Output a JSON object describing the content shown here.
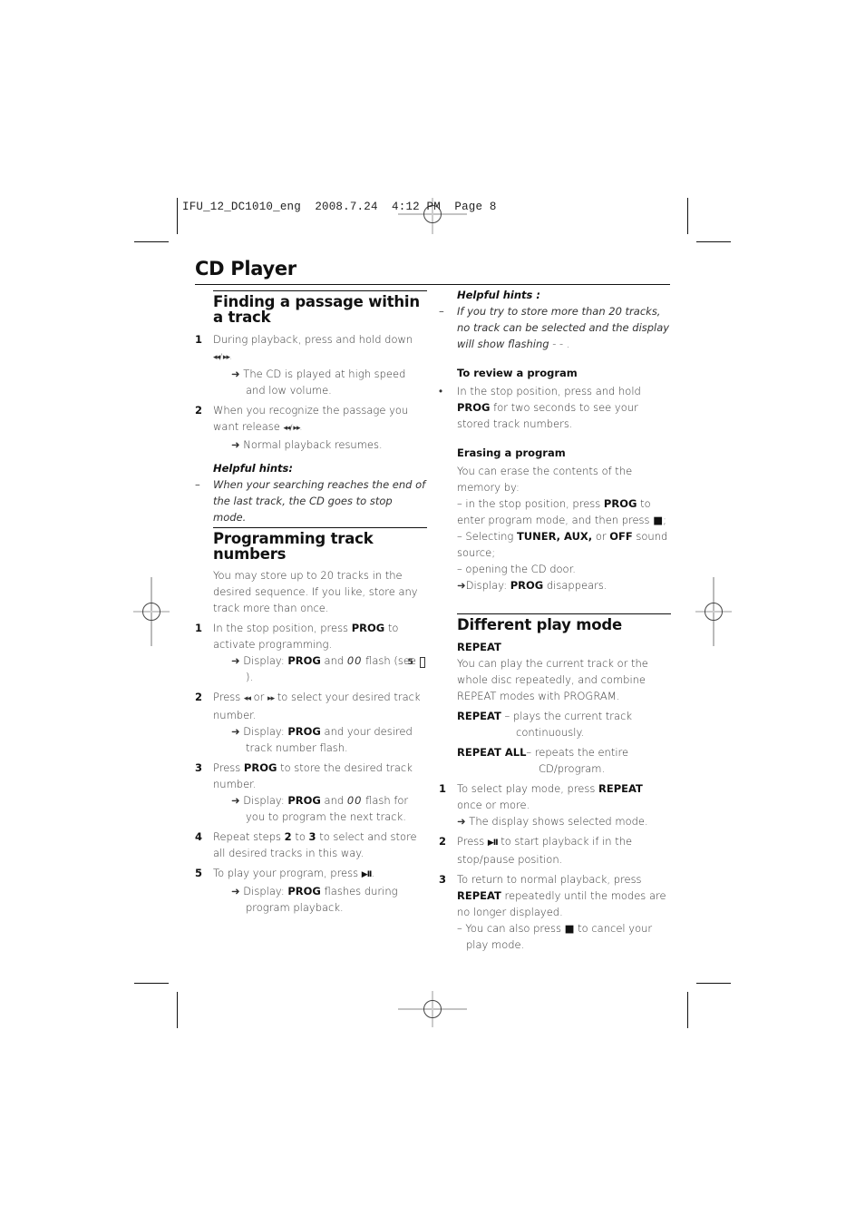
{
  "slug": {
    "file": "IFU_12_DC1010_eng",
    "date": "2008.7.24",
    "time": "4:12 PM",
    "page": "Page 8"
  },
  "page_title": "CD Player",
  "left": {
    "finding": {
      "heading": "Finding a passage within a track",
      "steps": [
        {
          "n": "1",
          "text": "During playback, press and hold down",
          "keys": "◂◂/ ▸▸.",
          "result": "➜ The CD is played at high speed and low volume."
        },
        {
          "n": "2",
          "text": "When you recognize the passage you want release",
          "keys": "◂◂/ ▸▸.",
          "result": "➜ Normal playback resumes."
        }
      ],
      "hints_title": "Helpful hints:",
      "hint_dash": "–",
      "hint": "When your searching reaches the end of the last track, the CD goes to stop mode."
    },
    "programming": {
      "heading": "Programming track numbers",
      "intro": "You may store up to 20 tracks in the desired sequence. If you like, store any track more than once.",
      "steps": [
        {
          "n": "1",
          "a": "In the stop position, press ",
          "b": "PROG",
          "c": " to activate programming.",
          "r1": "➜ Display: ",
          "r2": "PROG",
          "r3": " and ",
          "seg": "00",
          "r4": " flash (see ",
          "ref": "5",
          "r5": ")."
        },
        {
          "n": "2",
          "a": "Press ",
          "k1": "◂◂",
          "mid": " or ",
          "k2": "▸▸",
          "c": " to select your desired track number.",
          "r1": "➜ Display: ",
          "r2": "PROG",
          "r3": " and your desired track number flash."
        },
        {
          "n": "3",
          "a": "Press ",
          "b": "PROG",
          "c": " to store the desired track number.",
          "r1": "➜ Display: ",
          "r2": "PROG",
          "r3": " and ",
          "seg": "00",
          "r4": " flash for you to program the next track."
        },
        {
          "n": "4",
          "a": "Repeat steps ",
          "b1": "2",
          "mid": " to ",
          "b2": "3",
          "c": " to select and store all desired tracks in this way."
        },
        {
          "n": "5",
          "a": "To play your program, press ",
          "key": "▶II",
          "c": ".",
          "r1": "➜ Display: ",
          "r2": "PROG",
          "r3": " flashes during program playback."
        }
      ]
    }
  },
  "right": {
    "hints_title": "Helpful hints :",
    "hint_dash": "–",
    "hint": "If you try to store more than 20 tracks, no track can be selected and the display will show flashing",
    "hint_end": " - - .",
    "review": {
      "heading": "To review a program",
      "bullet": "•",
      "a": "In the stop position, press and hold ",
      "b": "PROG",
      "c": " for two seconds to see your stored track numbers."
    },
    "erasing": {
      "heading": "Erasing a program",
      "intro": "You can erase the contents of the memory by:",
      "l1a": "– in the stop position, press ",
      "l1b": "PROG",
      "l1c": " to enter program mode, and then press ",
      "stop": "■",
      "l1d": ";",
      "l2a": "– Selecting ",
      "l2b": "TUNER, AUX,",
      "l2c": " or ",
      "l2d": "OFF",
      "l2e": " sound source;",
      "l3": "– opening the CD door.",
      "l4a": "➜Display: ",
      "l4b": "PROG",
      "l4c": " disappears."
    },
    "playmode": {
      "heading": "Different play mode",
      "sub": "REPEAT",
      "intro": "You can play the current track or the whole disc repeatedly, and combine REPEAT modes with PROGRAM.",
      "m1_label": "REPEAT",
      "m1_text": " – plays the current track",
      "m1_cont": "continuously.",
      "m2_label": "REPEAT ALL",
      "m2_text": "– repeats the entire",
      "m2_cont": "CD/program.",
      "steps": [
        {
          "n": "1",
          "a": "To select play mode, press ",
          "b": "REPEAT",
          "c": " once or more.",
          "r": "➜ The display shows selected mode."
        },
        {
          "n": "2",
          "a": "Press ",
          "key": "▶II",
          "c": " to start playback if in the stop/pause position."
        },
        {
          "n": "3",
          "a": "To return to normal playback, press ",
          "b": "REPEAT",
          "c": " repeatedly until the modes are no longer displayed.",
          "r1": "– You can also press ",
          "stop": "■",
          "r2": " to cancel your play mode."
        }
      ]
    }
  }
}
